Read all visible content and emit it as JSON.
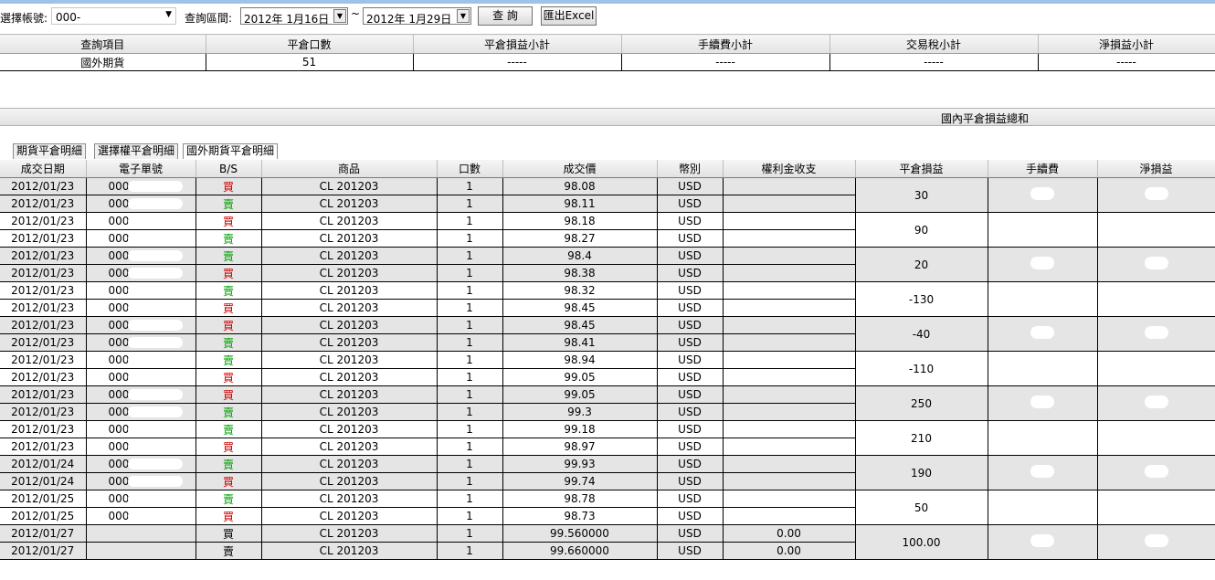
{
  "toolbar": {
    "account_label": "選擇帳號:",
    "account_value": "000-",
    "period_label": "查詢區間:",
    "date_from": "2012年  1月16日",
    "tilde": "~",
    "date_to": "2012年  1月29日",
    "query_button": "查 詢",
    "export_button": "匯出Excel"
  },
  "summary": {
    "headers": [
      "查詢項目",
      "平倉口數",
      "平倉損益小計",
      "手續費小計",
      "交易稅小計",
      "淨損益小計"
    ],
    "row": [
      "國外期貨",
      "51",
      "-----",
      "-----",
      "-----",
      "-----"
    ]
  },
  "domestic_total_label": "國內平倉損益總和",
  "tabs": [
    "期貨平倉明細",
    "選擇權平倉明細",
    "國外期貨平倉明細"
  ],
  "grid": {
    "headers": [
      "成交日期",
      "電子單號",
      "B/S",
      "商品",
      "口數",
      "成交價",
      "幣別",
      "權利金收支",
      "平倉損益",
      "手續費",
      "淨損益"
    ],
    "rows": [
      {
        "date": "2012/01/23",
        "order": "000-",
        "bs": "買",
        "product": "CL 201203",
        "qty": "1",
        "price": "98.08",
        "cur": "USD",
        "premium": ""
      },
      {
        "date": "2012/01/23",
        "order": "000-",
        "bs": "賣",
        "product": "CL 201203",
        "qty": "1",
        "price": "98.11",
        "cur": "USD",
        "premium": ""
      },
      {
        "date": "2012/01/23",
        "order": "000-",
        "bs": "買",
        "product": "CL 201203",
        "qty": "1",
        "price": "98.18",
        "cur": "USD",
        "premium": ""
      },
      {
        "date": "2012/01/23",
        "order": "000-",
        "bs": "賣",
        "product": "CL 201203",
        "qty": "1",
        "price": "98.27",
        "cur": "USD",
        "premium": ""
      },
      {
        "date": "2012/01/23",
        "order": "000",
        "bs": "賣",
        "product": "CL 201203",
        "qty": "1",
        "price": "98.4",
        "cur": "USD",
        "premium": ""
      },
      {
        "date": "2012/01/23",
        "order": "000",
        "bs": "買",
        "product": "CL 201203",
        "qty": "1",
        "price": "98.38",
        "cur": "USD",
        "premium": ""
      },
      {
        "date": "2012/01/23",
        "order": "000-",
        "bs": "賣",
        "product": "CL 201203",
        "qty": "1",
        "price": "98.32",
        "cur": "USD",
        "premium": ""
      },
      {
        "date": "2012/01/23",
        "order": "000-",
        "bs": "買",
        "product": "CL 201203",
        "qty": "1",
        "price": "98.45",
        "cur": "USD",
        "premium": ""
      },
      {
        "date": "2012/01/23",
        "order": "000",
        "bs": "買",
        "product": "CL 201203",
        "qty": "1",
        "price": "98.45",
        "cur": "USD",
        "premium": ""
      },
      {
        "date": "2012/01/23",
        "order": "000",
        "bs": "賣",
        "product": "CL 201203",
        "qty": "1",
        "price": "98.41",
        "cur": "USD",
        "premium": ""
      },
      {
        "date": "2012/01/23",
        "order": "000-",
        "bs": "賣",
        "product": "CL 201203",
        "qty": "1",
        "price": "98.94",
        "cur": "USD",
        "premium": ""
      },
      {
        "date": "2012/01/23",
        "order": "000-",
        "bs": "買",
        "product": "CL 201203",
        "qty": "1",
        "price": "99.05",
        "cur": "USD",
        "premium": ""
      },
      {
        "date": "2012/01/23",
        "order": "000",
        "bs": "買",
        "product": "CL 201203",
        "qty": "1",
        "price": "99.05",
        "cur": "USD",
        "premium": ""
      },
      {
        "date": "2012/01/23",
        "order": "000",
        "bs": "賣",
        "product": "CL 201203",
        "qty": "1",
        "price": "99.3",
        "cur": "USD",
        "premium": ""
      },
      {
        "date": "2012/01/23",
        "order": "000",
        "bs": "賣",
        "product": "CL 201203",
        "qty": "1",
        "price": "99.18",
        "cur": "USD",
        "premium": ""
      },
      {
        "date": "2012/01/23",
        "order": "000-",
        "bs": "買",
        "product": "CL 201203",
        "qty": "1",
        "price": "98.97",
        "cur": "USD",
        "premium": ""
      },
      {
        "date": "2012/01/24",
        "order": "000-",
        "bs": "賣",
        "product": "CL 201203",
        "qty": "1",
        "price": "99.93",
        "cur": "USD",
        "premium": ""
      },
      {
        "date": "2012/01/24",
        "order": "000-",
        "bs": "買",
        "product": "CL 201203",
        "qty": "1",
        "price": "99.74",
        "cur": "USD",
        "premium": ""
      },
      {
        "date": "2012/01/25",
        "order": "000",
        "bs": "賣",
        "product": "CL 201203",
        "qty": "1",
        "price": "98.78",
        "cur": "USD",
        "premium": ""
      },
      {
        "date": "2012/01/25",
        "order": "000-",
        "bs": "買",
        "product": "CL 201203",
        "qty": "1",
        "price": "98.73",
        "cur": "USD",
        "premium": ""
      },
      {
        "date": "2012/01/27",
        "order": "",
        "bs": "買",
        "product": "CL 201203",
        "qty": "1",
        "price": "99.560000",
        "cur": "USD",
        "premium": "0.00"
      },
      {
        "date": "2012/01/27",
        "order": "",
        "bs": "賣",
        "product": "CL 201203",
        "qty": "1",
        "price": "99.660000",
        "cur": "USD",
        "premium": "0.00"
      }
    ],
    "pnl": [
      "30",
      "90",
      "20",
      "-130",
      "-40",
      "-110",
      "250",
      "210",
      "190",
      "50",
      "100.00"
    ]
  },
  "colors": {
    "buy": "#cc0000",
    "sell": "#00a000",
    "shade_row": "#e5e5e5",
    "top_accent": "#9fc3e8"
  }
}
